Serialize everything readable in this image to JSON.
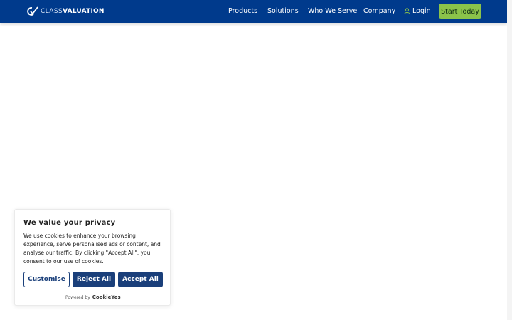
{
  "header": {
    "logo": {
      "light": "CLASS",
      "bold": "VALUATION",
      "icon": "class-valuation-logo-icon"
    },
    "nav": [
      {
        "label": "Products"
      },
      {
        "label": "Solutions"
      },
      {
        "label": "Who We Serve"
      },
      {
        "label": "Company"
      }
    ],
    "login": {
      "label": "Login",
      "icon": "user-icon"
    },
    "cta": {
      "label": "Start Today"
    }
  },
  "cookie_banner": {
    "title": "We value your privacy",
    "body": "We use cookies to enhance your browsing experience, serve personalised ads or content, and analyse our traffic. By clicking \"Accept All\", you consent to our use of cookies.",
    "customise_label": "Customise",
    "reject_label": "Reject All",
    "accept_label": "Accept All",
    "powered_by": "Powered by",
    "powered_brand": "CookieYes"
  },
  "colors": {
    "header_bg": "#003a8c",
    "cta_bg": "#8bc34a",
    "cookie_button": "#1a3f7a"
  }
}
